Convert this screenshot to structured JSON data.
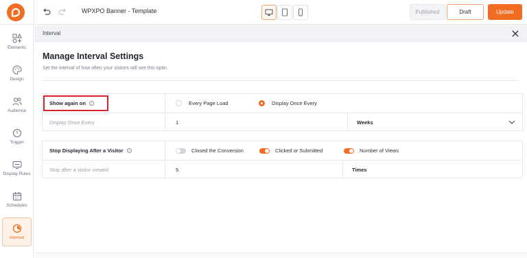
{
  "app": {
    "title": "WPXPO Banner - Template",
    "brand_color": "#f26c22"
  },
  "toolbar": {
    "undo_icon": "undo-icon",
    "redo_icon": "redo-icon",
    "devices": [
      "desktop-icon",
      "tablet-icon",
      "mobile-icon"
    ],
    "active_device": "desktop",
    "published_label": "Published",
    "draft_label": "Draft",
    "update_label": "Update"
  },
  "sidebar": {
    "items": [
      {
        "label": "Elements",
        "icon": "elements-icon"
      },
      {
        "label": "Design",
        "icon": "palette-icon"
      },
      {
        "label": "Audience",
        "icon": "users-icon"
      },
      {
        "label": "Trigger",
        "icon": "power-icon"
      },
      {
        "label": "Display Rules",
        "icon": "display-rules-icon"
      },
      {
        "label": "Schedules",
        "icon": "calendar-icon"
      },
      {
        "label": "Interval",
        "icon": "interval-icon",
        "active": true
      }
    ]
  },
  "panel": {
    "header": "Interval",
    "title": "Manage Interval Settings",
    "subtitle": "Set the interval of how often your visitors will see this optin."
  },
  "show_again": {
    "label": "Show again on",
    "options": [
      {
        "label": "Every Page Load",
        "selected": false
      },
      {
        "label": "Display Once Every",
        "selected": true
      }
    ],
    "interval_label": "Display Once Every",
    "interval_value": "1",
    "interval_unit": "Weeks"
  },
  "stop_displaying": {
    "label": "Stop Displaying After a Visitor",
    "options": [
      {
        "label": "Closed the Conversion",
        "on": false
      },
      {
        "label": "Clicked or Submitted",
        "on": true
      },
      {
        "label": "Number of Views",
        "on": true
      }
    ],
    "views_label": "Stop after a visitor viewed",
    "views_value": "5",
    "views_unit": "Times"
  }
}
